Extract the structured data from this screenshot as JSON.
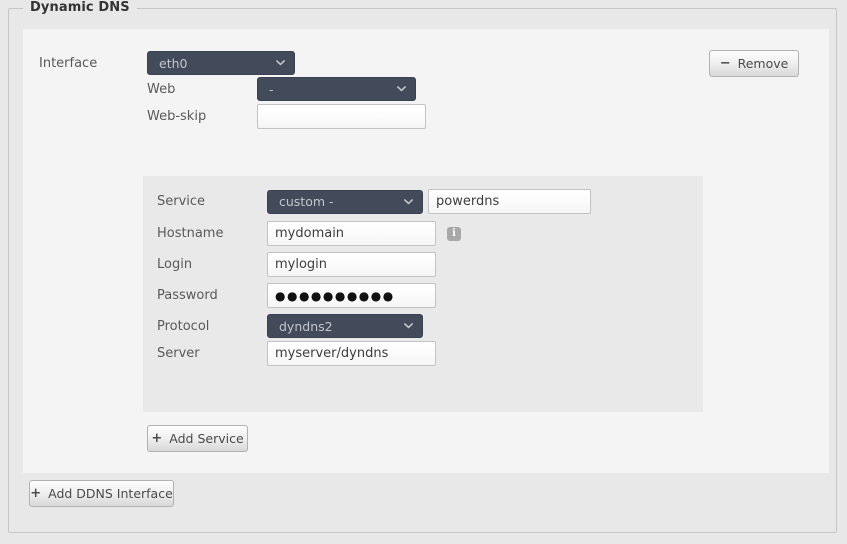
{
  "fieldset": {
    "legend": "Dynamic DNS"
  },
  "interface": {
    "label": "Interface",
    "value": "eth0",
    "remove_button": {
      "label": "Remove",
      "symbol": "−"
    },
    "web": {
      "label": "Web",
      "value": "-"
    },
    "web_skip": {
      "label": "Web-skip",
      "value": "",
      "placeholder": ""
    }
  },
  "service": {
    "rows": {
      "service": {
        "label": "Service",
        "select_value": "custom -",
        "text_value": "powerdns"
      },
      "hostname": {
        "label": "Hostname",
        "value": "mydomain",
        "info_glyph": "i"
      },
      "login": {
        "label": "Login",
        "value": "mylogin"
      },
      "password": {
        "label": "Password",
        "value": "●●●●●●●●●●"
      },
      "protocol": {
        "label": "Protocol",
        "value": "dyndns2"
      },
      "server": {
        "label": "Server",
        "value": "myserver/dyndns"
      }
    },
    "add_button": {
      "label": "Add Service",
      "symbol": "+"
    }
  },
  "footer": {
    "add_interface_button": {
      "label": "Add DDNS Interface",
      "symbol": "+"
    }
  },
  "colors": {
    "page_background": "#e8e8e8",
    "panel_background": "#f4f4f4",
    "service_background": "#e9e9e9",
    "select_background": "#434a5a",
    "select_text": "#c3c6cd",
    "border": "#c6c6c6",
    "label_text": "#595959"
  }
}
